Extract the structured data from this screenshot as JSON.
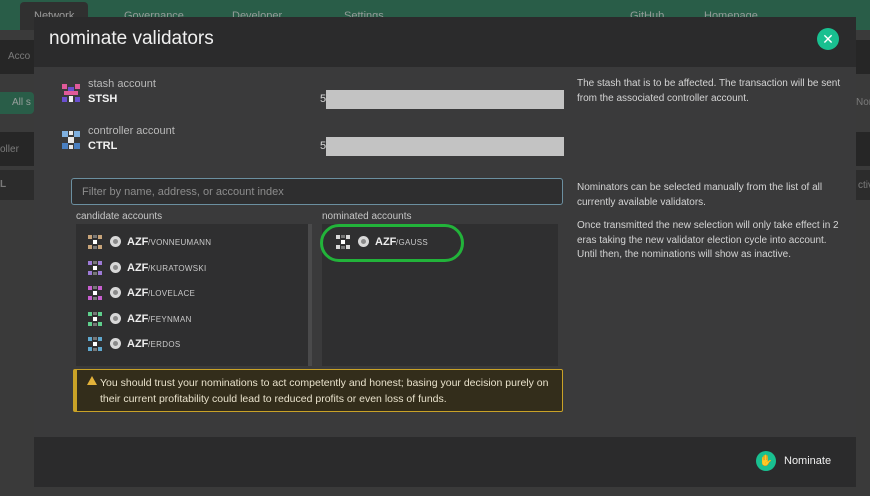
{
  "background": {
    "nav": [
      "Network",
      "Governance",
      "Developer",
      "Settings",
      "GitHub",
      "Homepage"
    ],
    "side": [
      "Acco",
      "All s",
      "oller",
      "L",
      "Nor",
      "ctiv"
    ]
  },
  "modal": {
    "title": "nominate validators",
    "stash": {
      "label": "stash account",
      "name": "STSH",
      "address_prefix": "5"
    },
    "controller": {
      "label": "controller account",
      "name": "CTRL",
      "address_prefix": "5"
    },
    "help_stash": "The stash that is to be affected. The transaction will be sent from the associated controller account.",
    "help_nominators_1": "Nominators can be selected manually from the list of all currently available validators.",
    "help_nominators_2": "Once transmitted the new selection will only take effect in 2 eras taking the new validator election cycle into account. Until then, the nominations will show as inactive.",
    "filter_placeholder": "Filter by name, address, or account index",
    "candidate_label": "candidate accounts",
    "nominated_label": "nominated accounts",
    "candidates": [
      {
        "prefix": "AZF",
        "suffix": "/VONNEUMANN",
        "color": "#c8a47a"
      },
      {
        "prefix": "AZF",
        "suffix": "/KURATOWSKI",
        "color": "#9d7ad6"
      },
      {
        "prefix": "AZF",
        "suffix": "/LOVELACE",
        "color": "#c85fcf"
      },
      {
        "prefix": "AZF",
        "suffix": "/FEYNMAN",
        "color": "#5fcf8c"
      },
      {
        "prefix": "AZF",
        "suffix": "/ERDOS",
        "color": "#5fa8cf"
      }
    ],
    "nominated": [
      {
        "prefix": "AZF",
        "suffix": "/GAUSS",
        "color": "#d8d8d8"
      }
    ],
    "warning": "You should trust your nominations to act competently and honest; basing your decision purely on their current profitability could lead to reduced profits or even loss of funds.",
    "nominate_label": "Nominate",
    "accent": "#19c090",
    "highlight_color": "#22b33a"
  }
}
